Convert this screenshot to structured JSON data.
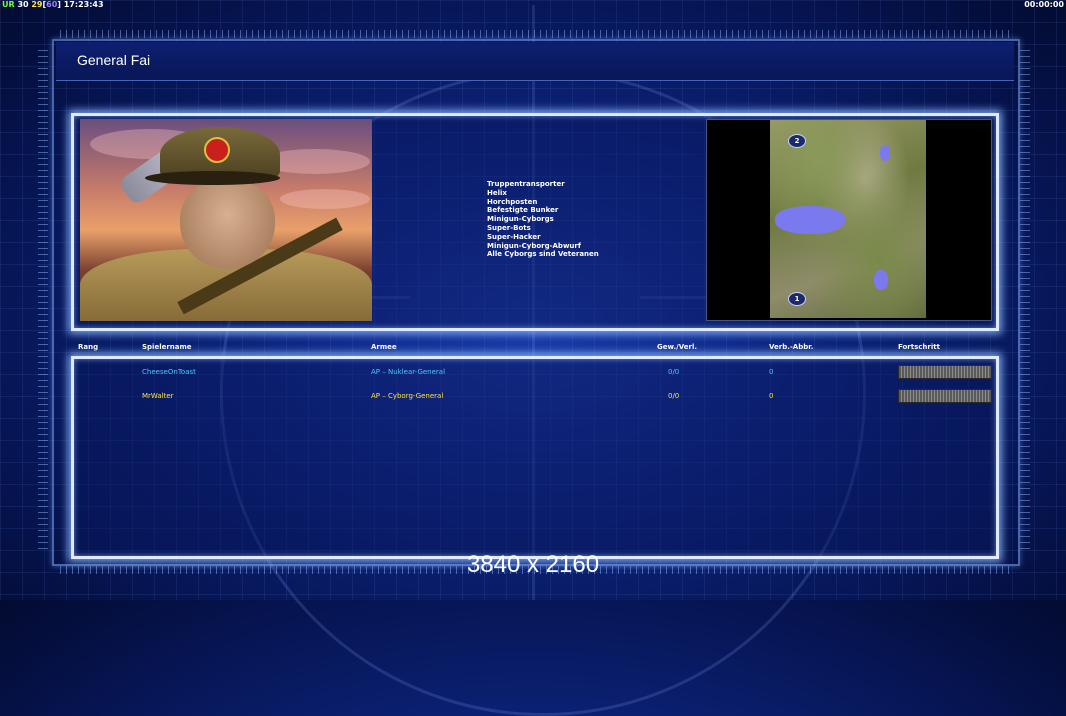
{
  "hud": {
    "left": [
      {
        "text": "UR",
        "color": "green"
      },
      {
        "text": " 30 ",
        "color": "white"
      },
      {
        "text": "29",
        "color": "yellow"
      },
      {
        "text": "[",
        "color": "white"
      },
      {
        "text": "60",
        "color": "purple"
      },
      {
        "text": "]",
        "color": "white"
      },
      {
        "text": " 17:23:43",
        "color": "white"
      }
    ],
    "right": "00:00:00"
  },
  "title": "General Fai",
  "units": [
    "Truppentransporter",
    "Helix",
    "Horchposten",
    "Befestigte Bunker",
    "Minigun-Cyborgs",
    "Super-Bots",
    "Super-Hacker",
    "Minigun-Cyborg-Abwurf",
    "Alle Cyborgs sind Veteranen"
  ],
  "minimap": {
    "spawns": [
      "1",
      "2"
    ]
  },
  "table": {
    "headers": {
      "rank": "Rang",
      "player": "Spielername",
      "army": "Armee",
      "winloss": "Gew./Verl.",
      "disconnects": "Verb.-Abbr.",
      "progress": "Fortschritt"
    },
    "rows": [
      {
        "rank": "",
        "player": "CheeseOnToast",
        "army": "AP – Nuklear-General",
        "winloss": "0/0",
        "disconnects": "0",
        "color": "#4ec8f0"
      },
      {
        "rank": "",
        "player": "MrWalter",
        "army": "AP – Cyborg-General",
        "winloss": "0/0",
        "disconnects": "0",
        "color": "#ffe040"
      }
    ]
  },
  "resolution_label": "3840 x 2160"
}
